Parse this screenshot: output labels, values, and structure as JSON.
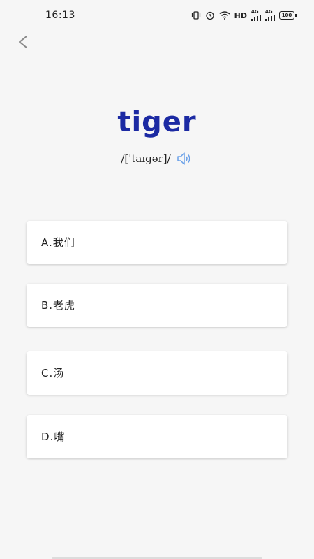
{
  "status_bar": {
    "time": "16:13",
    "hd_label": "HD",
    "network_1": "4G",
    "network_2": "4G",
    "battery": "100"
  },
  "word": "tiger",
  "phonetic": "/[ˈtaɪɡər]/",
  "options": [
    {
      "label": "A.我们"
    },
    {
      "label": "B.老虎"
    },
    {
      "label": "C.汤"
    },
    {
      "label": "D.嘴"
    }
  ],
  "colors": {
    "word": "#1c2aa3",
    "speaker": "#6aa0e8",
    "background": "#f6f6f6"
  },
  "icons": {
    "back": "chevron-left-icon",
    "speaker": "speaker-icon"
  }
}
